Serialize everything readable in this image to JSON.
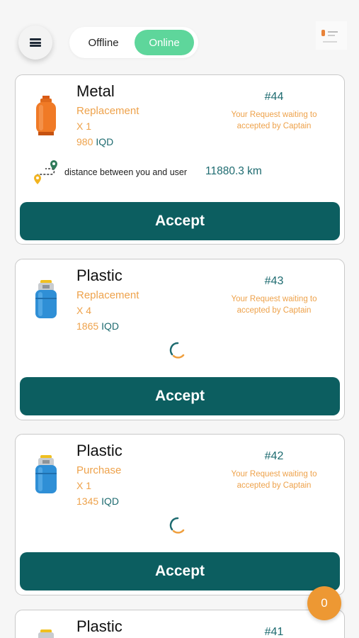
{
  "header": {
    "offline_label": "Offline",
    "online_label": "Online",
    "menu_icon": "hamburger-menu-icon"
  },
  "cards": [
    {
      "title": "Metal",
      "type": "Replacement",
      "qty": "X 1",
      "price": "980",
      "currency": "IQD",
      "order": "#44",
      "status": "Your Request waiting to accepted by Captain",
      "distance_label": "distance between you and user",
      "distance_value": "11880.3  km",
      "accept_label": "Accept"
    },
    {
      "title": "Plastic",
      "type": "Replacement",
      "qty": "X 4",
      "price": "1865",
      "currency": "IQD",
      "order": "#43",
      "status": "Your Request waiting to accepted by Captain",
      "accept_label": "Accept"
    },
    {
      "title": "Plastic",
      "type": "Purchase",
      "qty": "X 1",
      "price": "1345",
      "currency": "IQD",
      "order": "#42",
      "status": "Your Request waiting to accepted by Captain",
      "accept_label": "Accept"
    },
    {
      "title": "Plastic",
      "order": "#41"
    }
  ],
  "cart_badge": "0",
  "colors": {
    "accent_teal": "#0c5e60",
    "online_green": "#5ed69b",
    "orange": "#eea24b",
    "badge_orange": "#ed9833"
  }
}
